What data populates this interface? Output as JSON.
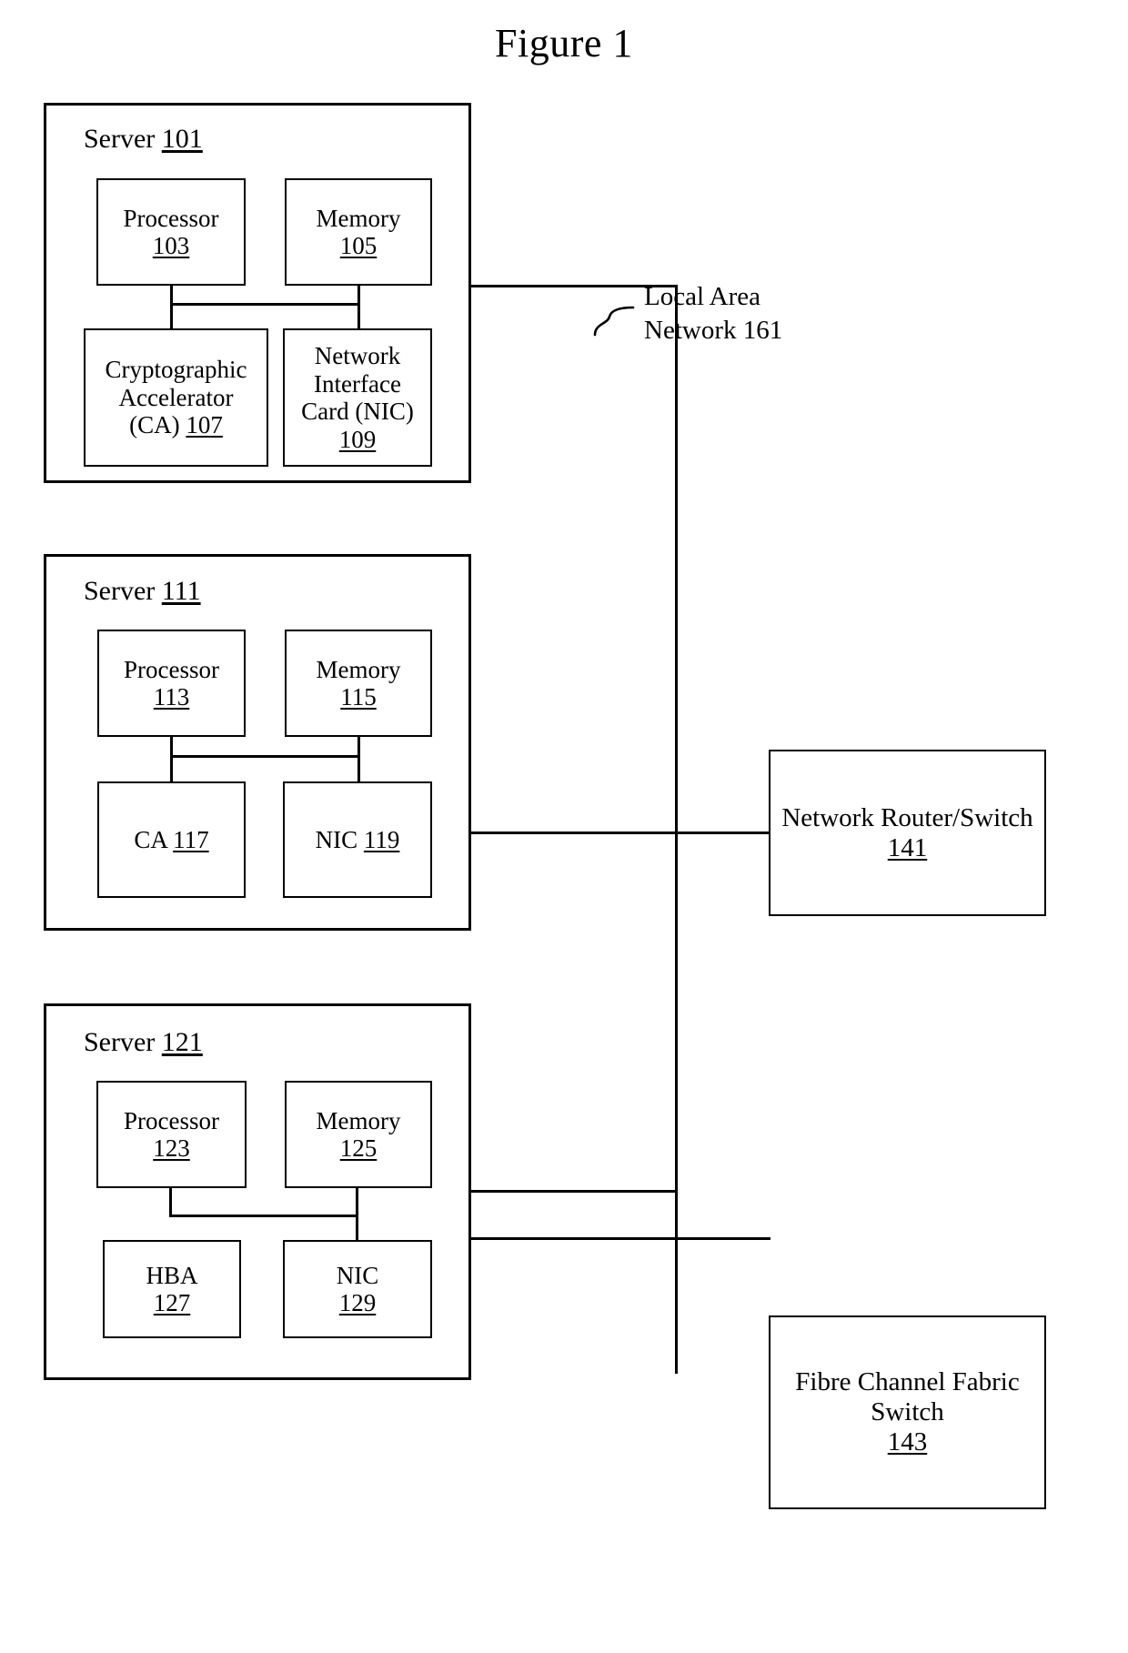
{
  "figure": {
    "title": "Figure 1"
  },
  "servers": [
    {
      "name": "server-101",
      "label_text": "Server",
      "label_num": "101",
      "components": [
        {
          "name": "processor",
          "line1": "Processor",
          "num": "103"
        },
        {
          "name": "memory",
          "line1": "Memory",
          "num": "105"
        },
        {
          "name": "crypto-accelerator",
          "line1": "Cryptographic",
          "line2": "Accelerator",
          "line3": "(CA)",
          "num": "107"
        },
        {
          "name": "nic",
          "line1": "Network",
          "line2": "Interface",
          "line3": "Card (NIC)",
          "num": "109"
        }
      ]
    },
    {
      "name": "server-111",
      "label_text": "Server",
      "label_num": "111",
      "components": [
        {
          "name": "processor",
          "line1": "Processor",
          "num": "113"
        },
        {
          "name": "memory",
          "line1": "Memory",
          "num": "115"
        },
        {
          "name": "crypto-accelerator",
          "line1": "CA",
          "num": "117"
        },
        {
          "name": "nic",
          "line1": "NIC",
          "num": "119"
        }
      ]
    },
    {
      "name": "server-121",
      "label_text": "Server",
      "label_num": "121",
      "components": [
        {
          "name": "processor",
          "line1": "Processor",
          "num": "123"
        },
        {
          "name": "memory",
          "line1": "Memory",
          "num": "125"
        },
        {
          "name": "hba",
          "line1": "HBA",
          "num": "127"
        },
        {
          "name": "nic",
          "line1": "NIC",
          "num": "129"
        }
      ]
    }
  ],
  "network_devices": [
    {
      "name": "network-router-switch",
      "line1": "Network Router/Switch",
      "num": "141"
    },
    {
      "name": "fibre-channel-fabric-switch",
      "line1": "Fibre Channel Fabric",
      "line2": "Switch",
      "num": "143"
    }
  ],
  "annotations": {
    "lan": {
      "line1": "Local Area",
      "line2": "Network 161"
    }
  },
  "colors": {
    "line": "#000000",
    "background": "#ffffff"
  }
}
